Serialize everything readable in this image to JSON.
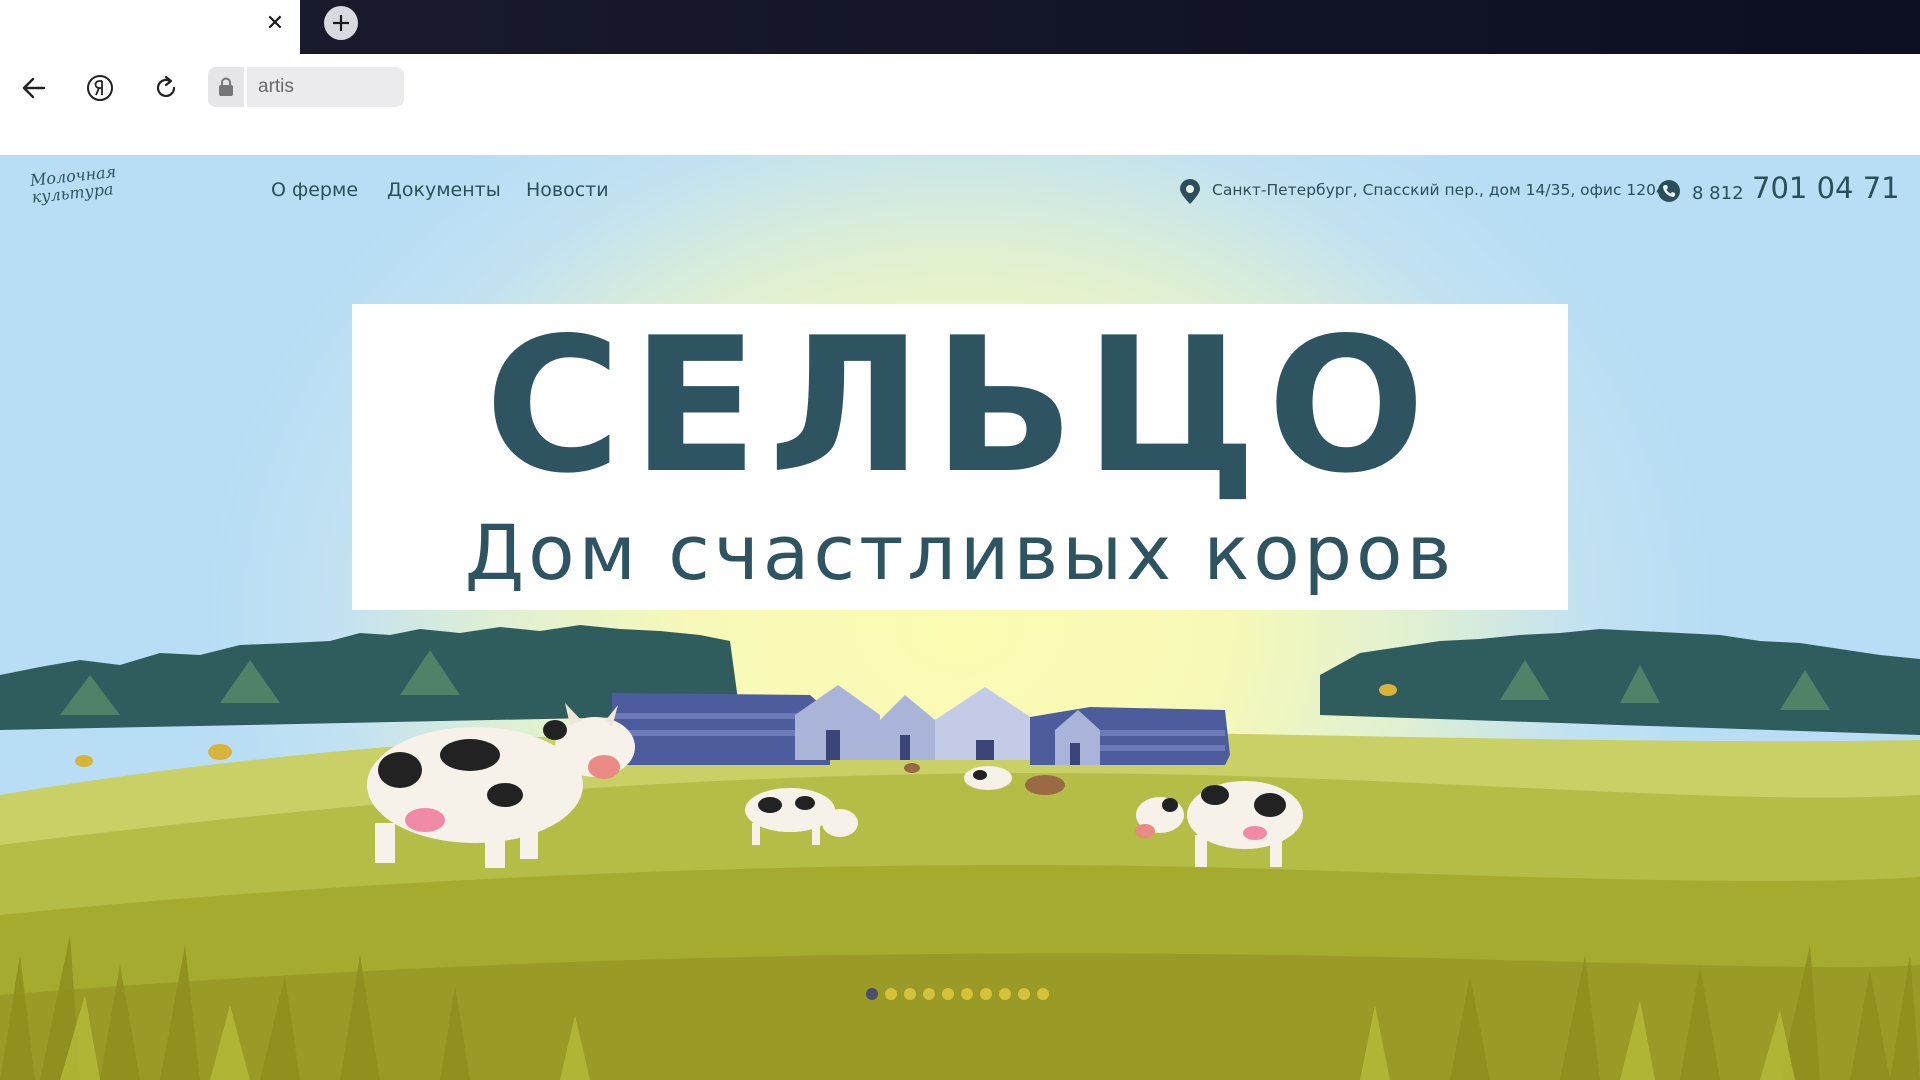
{
  "browser": {
    "tab_close_icon": "close-icon",
    "new_tab_icon": "plus-icon",
    "back_icon": "arrow-left-icon",
    "yandex_icon": "yandex-icon",
    "reload_icon": "reload-icon",
    "lock_icon": "lock-icon",
    "address_text": "artis"
  },
  "site": {
    "logo_text_line1": "Молочная",
    "logo_text_line2": "культура",
    "nav": [
      {
        "label": "О ферме"
      },
      {
        "label": "Документы"
      },
      {
        "label": "Новости"
      }
    ],
    "address": "Санкт-Петербург, Спасский пер., дом 14/35, офис 1204",
    "phone_code": "8 812",
    "phone_number": "701 04 71",
    "colors": {
      "primary": "#2d5460",
      "sky": "#b8ddf5",
      "sun": "#fbfcb2",
      "grass": "#a9b73a",
      "slider_active": "#4c4f6e",
      "slider_inactive": "#d6c23a"
    }
  },
  "hero": {
    "title": "СЕЛЬЦО",
    "subtitle": "Дом счастливых коров",
    "slides_total": 10,
    "slide_active": 1
  }
}
